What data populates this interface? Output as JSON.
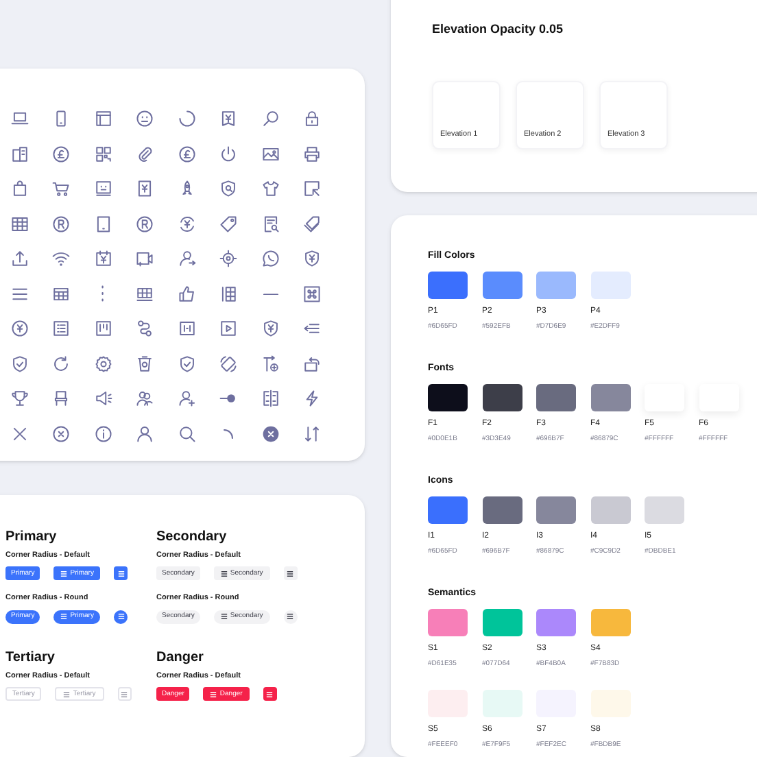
{
  "button_groups": [
    {
      "title": "Primary",
      "kind": "primary",
      "variants": [
        {
          "label": "Corner Radius - Default",
          "kind": "default",
          "buttons": [
            {
              "kind": "text",
              "label": "Primary"
            },
            {
              "kind": "icon_text",
              "label": "Primary"
            },
            {
              "kind": "icon"
            }
          ]
        },
        {
          "label": "Corner Radius - Round",
          "kind": "round",
          "buttons": [
            {
              "kind": "text",
              "label": "Primary"
            },
            {
              "kind": "icon_text",
              "label": "Primary"
            },
            {
              "kind": "icon"
            }
          ]
        }
      ]
    },
    {
      "title": "Secondary",
      "kind": "secondary",
      "variants": [
        {
          "label": "Corner Radius - Default",
          "kind": "default",
          "buttons": [
            {
              "kind": "text",
              "label": "Secondary"
            },
            {
              "kind": "icon_text",
              "label": "Secondary"
            },
            {
              "kind": "icon"
            }
          ]
        },
        {
          "label": "Corner Radius - Round",
          "kind": "round",
          "buttons": [
            {
              "kind": "text",
              "label": "Secondary"
            },
            {
              "kind": "icon_text",
              "label": "Secondary"
            },
            {
              "kind": "icon"
            }
          ]
        }
      ]
    },
    {
      "title": "Tertiary",
      "kind": "tertiary",
      "variants": [
        {
          "label": "Corner Radius - Default",
          "kind": "default",
          "buttons": [
            {
              "kind": "text",
              "label": "Tertiary"
            },
            {
              "kind": "icon_text",
              "label": "Tertiary"
            },
            {
              "kind": "icon"
            }
          ]
        }
      ]
    },
    {
      "title": "Danger",
      "kind": "danger",
      "variants": [
        {
          "label": "Corner Radius - Default",
          "kind": "default",
          "buttons": [
            {
              "kind": "text",
              "label": "Danger"
            },
            {
              "kind": "icon_text",
              "label": "Danger"
            },
            {
              "kind": "icon"
            }
          ]
        }
      ]
    }
  ],
  "elevation": {
    "title": "Elevation Opacity 0.05",
    "cards": [
      {
        "label": "Elevation 1"
      },
      {
        "label": "Elevation 2"
      },
      {
        "label": "Elevation 3"
      }
    ]
  },
  "palettes": [
    {
      "title": "Fill Colors",
      "rows": [
        [
          {
            "code": "P1",
            "hex": "#6D65FD",
            "color": "#3b6ffd"
          },
          {
            "code": "P2",
            "hex": "#592EFB",
            "color": "#5a8cfd"
          },
          {
            "code": "P3",
            "hex": "#D7D6E9",
            "color": "#9ab9fd"
          },
          {
            "code": "P4",
            "hex": "#E2DFF9",
            "color": "#e4ecfe"
          }
        ]
      ]
    },
    {
      "title": "Fonts",
      "rows": [
        [
          {
            "code": "F1",
            "hex": "#0D0E1B",
            "color": "#0d0e1b"
          },
          {
            "code": "F2",
            "hex": "#3D3E49",
            "color": "#3d3e49"
          },
          {
            "code": "F3",
            "hex": "#696B7F",
            "color": "#696b7f"
          },
          {
            "code": "F4",
            "hex": "#86879C",
            "color": "#86879c"
          },
          {
            "code": "F5",
            "hex": "#FFFFFF",
            "color": "#ffffff"
          },
          {
            "code": "F6",
            "hex": "#FFFFFF",
            "color": "#ffffff"
          }
        ]
      ]
    },
    {
      "title": "Icons",
      "rows": [
        [
          {
            "code": "I1",
            "hex": "#6D65FD",
            "color": "#3a6ffd"
          },
          {
            "code": "I2",
            "hex": "#696B7F",
            "color": "#696b7f"
          },
          {
            "code": "I3",
            "hex": "#86879C",
            "color": "#86879c"
          },
          {
            "code": "I4",
            "hex": "#C9C9D2",
            "color": "#c9c9d2"
          },
          {
            "code": "I5",
            "hex": "#DBDBE1",
            "color": "#dbdbe1"
          }
        ]
      ]
    },
    {
      "title": "Semantics",
      "rows": [
        [
          {
            "code": "S1",
            "hex": "#D61E35",
            "color": "#f77fb8"
          },
          {
            "code": "S2",
            "hex": "#077D64",
            "color": "#00c49a"
          },
          {
            "code": "S3",
            "hex": "#BF4B0A",
            "color": "#ab88fb"
          },
          {
            "code": "S4",
            "hex": "#F7B83D",
            "color": "#f7b83d"
          }
        ],
        [
          {
            "code": "S5",
            "hex": "#FEEEF0",
            "color": "#fdeef0"
          },
          {
            "code": "S6",
            "hex": "#E7F9F5",
            "color": "#e7f9f5"
          },
          {
            "code": "S7",
            "hex": "#FEF2EC",
            "color": "#f5f3fe"
          },
          {
            "code": "S8",
            "hex": "#FBDB9E",
            "color": "#fef8ea"
          }
        ]
      ]
    }
  ]
}
